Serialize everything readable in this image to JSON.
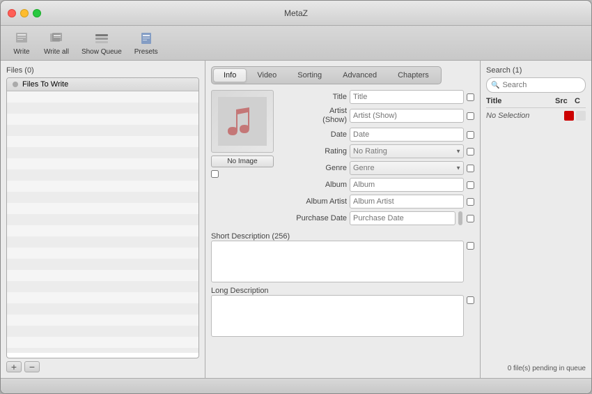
{
  "window": {
    "title": "MetaZ"
  },
  "toolbar": {
    "write_label": "Write",
    "writeall_label": "Write all",
    "showqueue_label": "Show Queue",
    "presets_label": "Presets"
  },
  "files_panel": {
    "title": "Files (0)",
    "header_label": "Files To Write",
    "add_button": "+",
    "remove_button": "−"
  },
  "tabs": {
    "info": "Info",
    "video": "Video",
    "sorting": "Sorting",
    "advanced": "Advanced",
    "chapters": "Chapters",
    "active": "Info"
  },
  "info_form": {
    "no_image_label": "No Image",
    "fields": [
      {
        "label": "Title",
        "placeholder": "Title",
        "type": "text"
      },
      {
        "label": "Artist\n(Show)",
        "placeholder": "Artist (Show)",
        "type": "text"
      },
      {
        "label": "Date",
        "placeholder": "Date",
        "type": "text"
      },
      {
        "label": "Rating",
        "placeholder": "No Rating",
        "type": "select"
      },
      {
        "label": "Genre",
        "placeholder": "Genre",
        "type": "select"
      },
      {
        "label": "Album",
        "placeholder": "Album",
        "type": "text"
      },
      {
        "label": "Album Artist",
        "placeholder": "Album Artist",
        "type": "text"
      },
      {
        "label": "Purchase Date",
        "placeholder": "Purchase Date",
        "type": "text"
      }
    ],
    "short_description_label": "Short Description (256)",
    "long_description_label": "Long Description"
  },
  "search_panel": {
    "title": "Search (1)",
    "placeholder": "Search",
    "col_title": "Title",
    "col_src": "Src",
    "col_c": "C",
    "result_label": "No Selection"
  },
  "status": {
    "pending": "0 file(s) pending in queue"
  }
}
